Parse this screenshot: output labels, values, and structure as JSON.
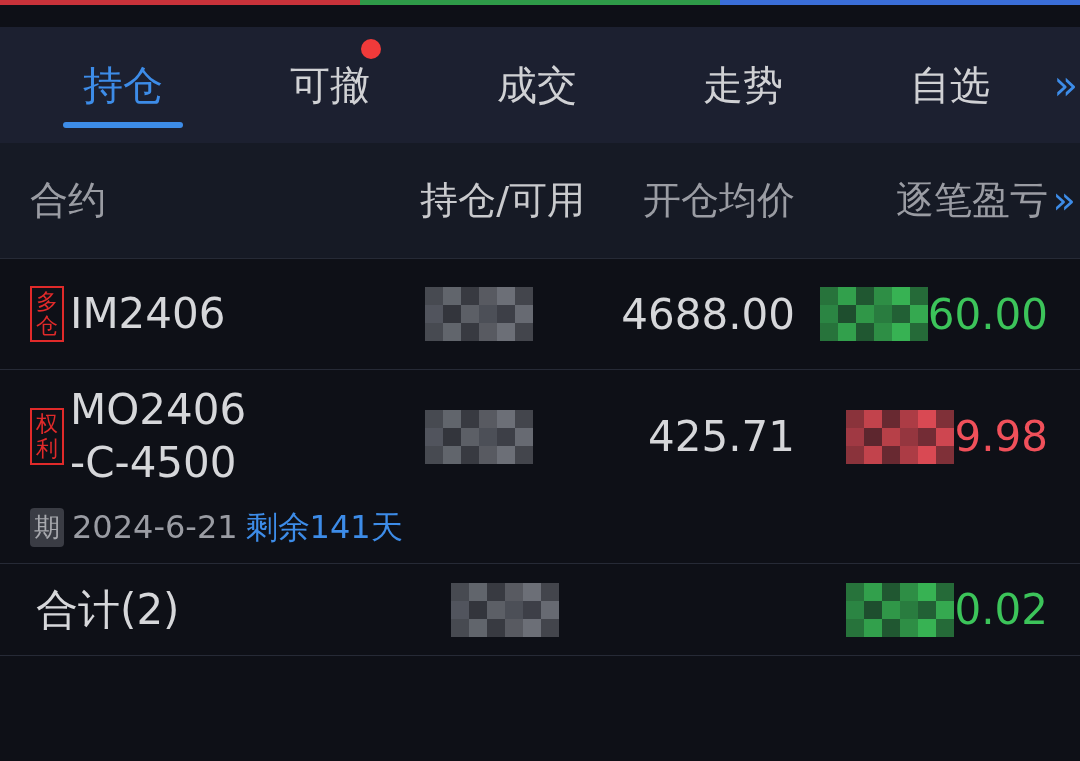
{
  "tabs": [
    {
      "label": "持仓",
      "selected": true,
      "dot": false
    },
    {
      "label": "可撤",
      "selected": false,
      "dot": true
    },
    {
      "label": "成交",
      "selected": false,
      "dot": false
    },
    {
      "label": "走势",
      "selected": false,
      "dot": false
    },
    {
      "label": "自选",
      "selected": false,
      "dot": false
    }
  ],
  "tabs_more": "»",
  "columns": [
    "合约",
    "持仓/可用",
    "开仓均价",
    "逐笔盈亏"
  ],
  "columns_more": "»",
  "rows": [
    {
      "tag": "多仓",
      "contract": [
        "IM2406"
      ],
      "position": {
        "kind": "masked"
      },
      "avg_price": "4688.00",
      "pnl": {
        "text": "60.00",
        "masked": true,
        "color": "#3cc45a"
      }
    },
    {
      "tag": "权利",
      "contract": [
        "MO2406",
        "-C-4500"
      ],
      "position": {
        "kind": "masked"
      },
      "avg_price": "425.71",
      "pnl": {
        "text": "9.98",
        "masked": true,
        "color": "#f0505a"
      },
      "expiry": {
        "badge": "期",
        "date": "2024-6-21",
        "remaining": "剩余141天"
      }
    }
  ],
  "total": {
    "label": "合计(2)",
    "position": {
      "kind": "masked"
    },
    "pnl": {
      "text": "0.02",
      "masked": true,
      "color": "#3cc45a"
    }
  }
}
